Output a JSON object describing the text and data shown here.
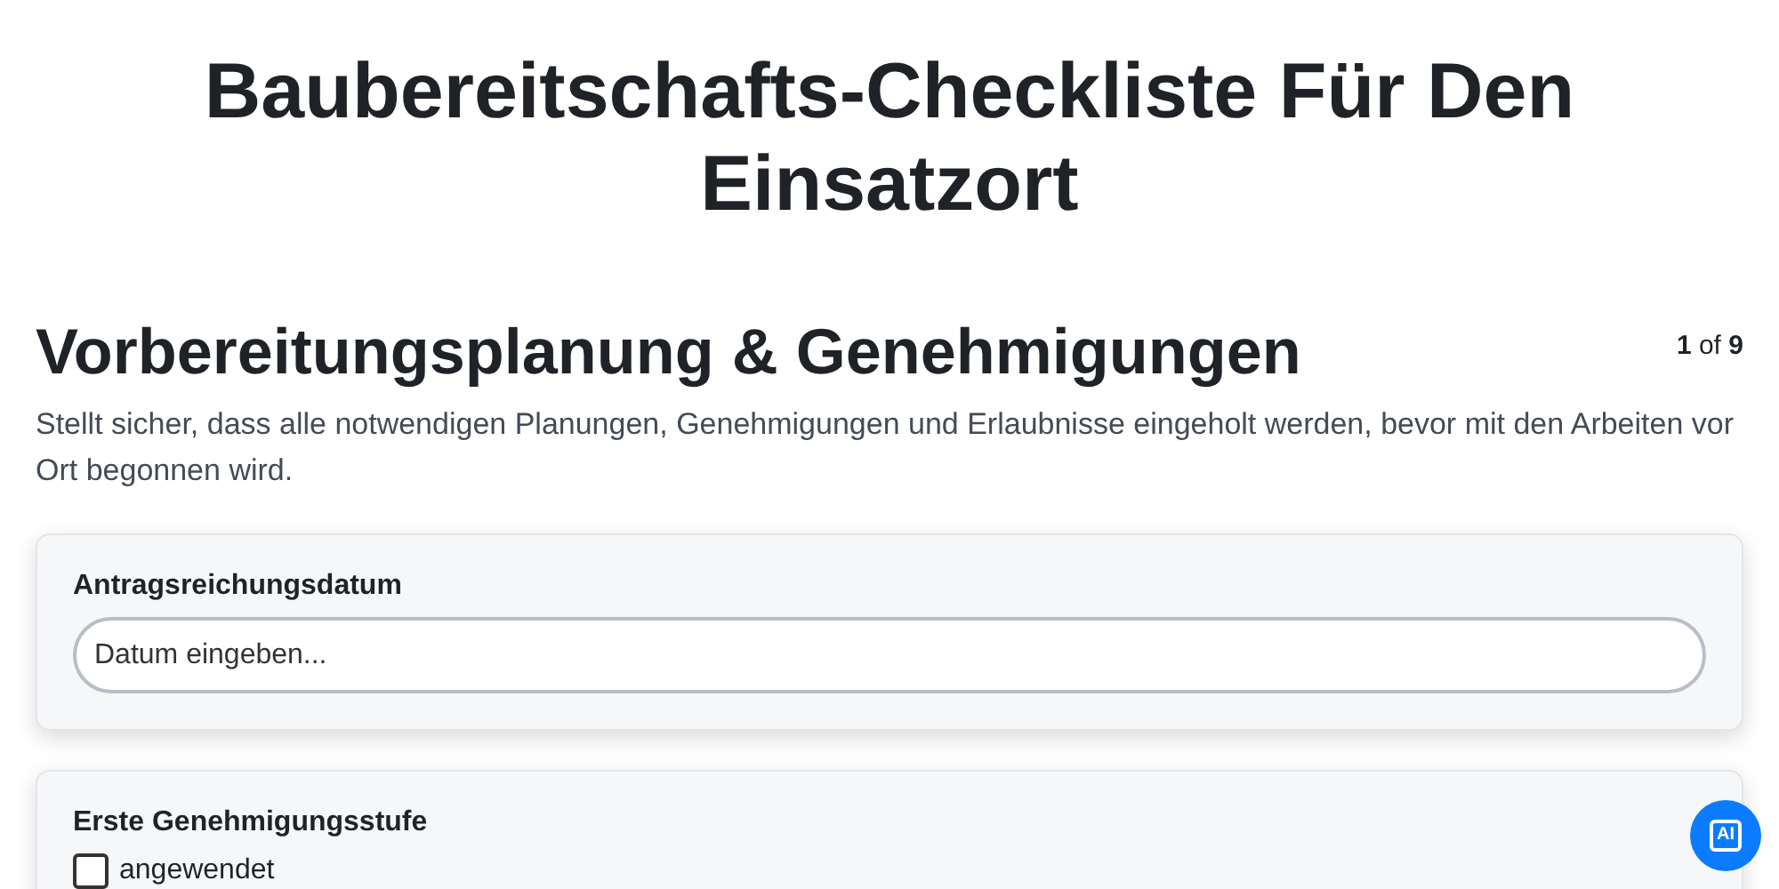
{
  "title": "Baubereitschafts-Checkliste Für Den Einsatzort",
  "section": {
    "heading": "Vorbereitungsplanung & Genehmigungen",
    "counter": "**1** of **9**",
    "description": "Stellt sicher, dass alle notwendigen Planungen, Genehmigungen und Erlaubnisse eingeholt werden, bevor mit den Arbeiten vor Ort begonnen wird."
  },
  "questions": [
    {
      "kind": "date",
      "label": "Antragsreichungsdatum",
      "placeholder": "Datum eingeben..."
    },
    {
      "kind": "checkbox",
      "label": "Erste Genehmigungsstufe",
      "option": "angewendet",
      "checked": false
    }
  ],
  "assistant_button": {
    "label": "AI"
  }
}
